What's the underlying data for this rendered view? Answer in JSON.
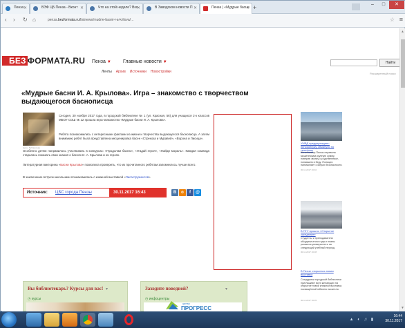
{
  "browser": {
    "tabs": [
      {
        "label": "Пенза",
        "active": false
      },
      {
        "label": "ВЭФ ЦБ Пенза - Вконт",
        "active": false
      },
      {
        "label": "Что на этой неделе? Вко",
        "active": false
      },
      {
        "label": "В Заводском новости П",
        "active": false
      },
      {
        "label": "Пенза | «Мудрые басни",
        "active": true
      }
    ],
    "new_tab": "+",
    "window_buttons": {
      "minimize": "–",
      "maximize": "□",
      "close": "✕"
    },
    "url_prefix": "penza.",
    "url_domain": "bezformata.ru",
    "url_path": "/listnews/mudrie-basni-i-a-krilova/...",
    "nav": {
      "back": "‹",
      "forward": "›",
      "reload": "↻",
      "home": "⌂"
    }
  },
  "site": {
    "logo_bez": "БЕЗ",
    "logo_rest": "ФОРМАТА.RU",
    "city": "Пенза",
    "city_arrow": "▼",
    "top_news": "Главные новости",
    "top_news_arrow": "▼",
    "subnav": [
      "Ленты",
      "Архив",
      "Источники",
      "Новостройки"
    ],
    "search_placeholder": "",
    "search_button": "Найти",
    "advanced_search": "Расширенный поиск"
  },
  "article": {
    "title": "«Мудрые басни И. А. Крылова». Игра – знакомство с творчеством выдающегося баснописца",
    "img_caption": "фото: библиотека",
    "p1": "Сегодня, 30 ноября 2017 года, в городской библиотеке № 1 (ул. Красная, 56) для учащихся 2-х классов МБОУ СОШ № 12 прошла игра-знакомство «Мудрые басни И. А. Крылова».",
    "p2": "Ребята познакомились с интересными фактами из жизни и творчества выдающегося баснописца. А затем вниманию ребят была представлена инсценировка басен «Стрекоза и Муравей», «Ворона и Лисица».",
    "p2b": "Особенно детям понравилось участвовать в конкурсах: «Продолжи басню», «Угадай героя», «Найди мораль». Каждая команда старалась показать свои знания о баснях И. А. Крылова и их героях.",
    "p3_pre": "Литературная викторина «",
    "p3_link": "Басни Крылова",
    "p3_post": "» позволила проверить, что из прочитанного ребятам запомнилось лучше всего.",
    "p4_pre": "В заключение встречи школьники познакомились с книжной выставкой «",
    "p4_link": "Лисаструментов",
    "p4_post": "»",
    "source_label": "Источник:",
    "source_link": "ЦБС города Пензы",
    "source_date": "30.11.2017  16:43"
  },
  "share": [
    {
      "name": "vk",
      "glyph": "В",
      "color": "#4a76a8"
    },
    {
      "name": "odnoklassniki",
      "glyph": "о",
      "color": "#ee8208"
    },
    {
      "name": "facebook",
      "glyph": "f",
      "color": "#3b5998"
    },
    {
      "name": "moimir",
      "glyph": "@",
      "color": "#168de2"
    }
  ],
  "sidebar": {
    "news": [
      {
        "title": "УМВД предупреждает: пенсионерку обманули по телефону",
        "text": "Жительница Пензы перевела мошенникам крупную сумму, поверив звонку о родственнике, попавшем в беду. Полиция напоминает о мерах безопасности.",
        "date": "30.11.2017 16:40"
      },
      {
        "title": "В ПГУ прошло «Открытое заседание»",
        "text": "Студенты и преподаватели обсудили итоги года и планы развития университета на следующий учебный период.",
        "date": "30.11.2017 16:38"
      },
      {
        "title": "В Пензе открылась новая выставка",
        "text": "Сотрудники городской библиотеки приглашают всех желающих на открытие новой книжной выставки, посвящённой юбилею писателя.",
        "date": "30.11.2017 16:35"
      }
    ]
  },
  "widgets": [
    {
      "title": "Вы библиотекарь? Курсы для вас!",
      "caret": "▾",
      "sub": "◷ курсы"
    },
    {
      "title": "Заходите поведной?",
      "caret": "▾",
      "sub": "◷ инфоцентры",
      "logo_pre": "центр",
      "logo_word": "ПРОГРЕСС"
    }
  ],
  "taskbar": {
    "icons": [
      "explorer-icon",
      "folder-icon",
      "media-icon",
      "chrome-icon",
      "app-icon",
      "opera-icon"
    ],
    "tray_icons": "▲ ◐ ♫ ▮",
    "time": "16:44",
    "date": "30.11.2017",
    "lang": "RU"
  },
  "colors": {
    "brand_red": "#d12a2a",
    "link_blue": "#3355cc",
    "widget_bg": "#dde9c9",
    "taskbar": "#1c3658"
  }
}
